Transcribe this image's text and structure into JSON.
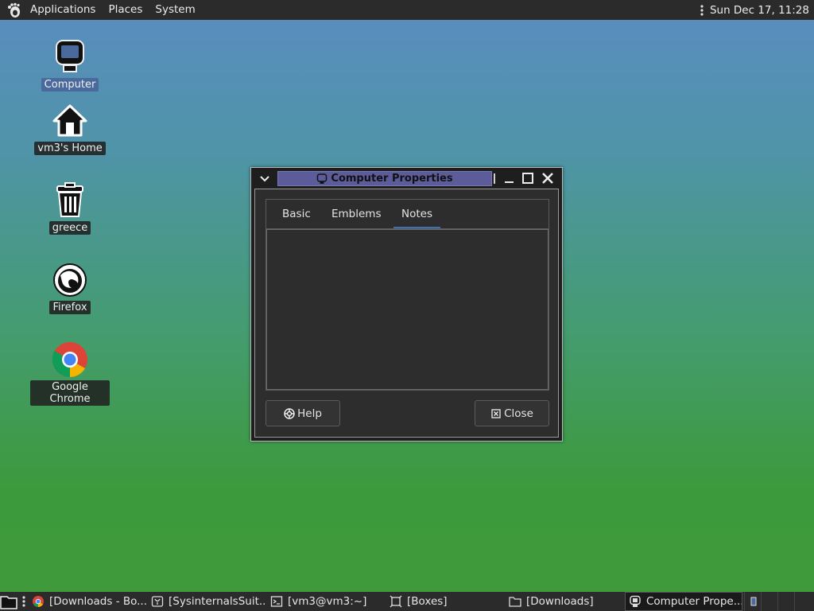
{
  "top_panel": {
    "menus": [
      "Applications",
      "Places",
      "System"
    ],
    "clock": "Sun Dec 17, 11:28"
  },
  "desktop_icons": [
    {
      "label": "Computer",
      "icon": "computer-icon",
      "selected": true
    },
    {
      "label": "vm3's Home",
      "icon": "home-icon"
    },
    {
      "label": "greece",
      "icon": "trash-icon"
    },
    {
      "label": "Firefox",
      "icon": "firefox-icon"
    },
    {
      "label": "Google Chrome",
      "icon": "chrome-icon"
    }
  ],
  "dialog": {
    "title": "Computer Properties",
    "tabs": [
      "Basic",
      "Emblems",
      "Notes"
    ],
    "active_tab": "Notes",
    "notes_text": "",
    "help_label": "Help",
    "close_label": "Close"
  },
  "taskbar": {
    "tasks": [
      {
        "label": "[Downloads - Bo...",
        "icon": "chrome-icon"
      },
      {
        "label": "[SysinternalsSuit...",
        "icon": "wine-icon"
      },
      {
        "label": "[vm3@vm3:~]",
        "icon": "terminal-icon"
      },
      {
        "label": "[Boxes]",
        "icon": "boxes-icon"
      },
      {
        "label": "[Downloads]",
        "icon": "folder-icon"
      },
      {
        "label": "Computer Prope...",
        "icon": "computer-icon",
        "active": true
      }
    ]
  },
  "colors": {
    "panel": "#2b2b2b",
    "dialog_bg": "#2d2d2d",
    "title_highlight": "#5c5c9a",
    "tab_underline": "#3d6fb8"
  }
}
